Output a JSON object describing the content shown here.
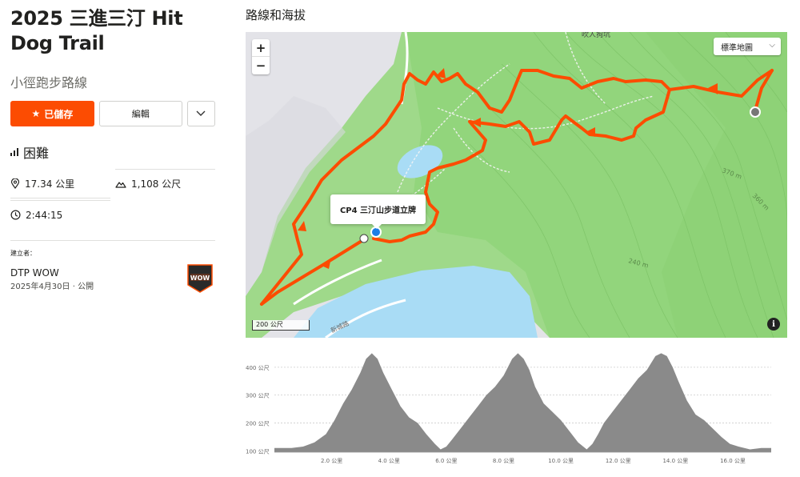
{
  "route": {
    "title": "2025 三進三汀 Hit Dog Trail",
    "type": "小徑跑步路線",
    "save_label": "已儲存",
    "edit_label": "編輯",
    "difficulty": "困難",
    "distance": "17.34 公里",
    "elevation_gain": "1,108 公尺",
    "duration": "2:44:15"
  },
  "creator": {
    "label": "建立者：",
    "name": "DTP WOW",
    "date": "2025年4月30日 · 公開",
    "badge_text": "WOW"
  },
  "map": {
    "section_title": "路線和海拔",
    "zoom_in": "+",
    "zoom_out": "−",
    "map_type": "標準地圖",
    "popup": "CP4 三汀山步道立牌",
    "scale": "200 公尺",
    "info": "i",
    "labels": [
      "吹人狗坑",
      "370 m",
      "360 m",
      "240 m",
      "新城路"
    ],
    "colors": {
      "route": "#fc4c02",
      "land": "#9fd98a",
      "water": "#a9dcf5",
      "urban": "#e6e6ea"
    }
  },
  "chart_data": {
    "type": "area",
    "title": "",
    "xlabel": "",
    "ylabel": "",
    "x_ticks": [
      "2.0 公里",
      "4.0 公里",
      "6.0 公里",
      "8.0 公里",
      "10.0 公里",
      "12.0 公里",
      "14.0 公里",
      "16.0 公里"
    ],
    "y_ticks": [
      "100 公尺",
      "200 公尺",
      "300 公尺",
      "400 公尺"
    ],
    "xlim": [
      0,
      17.34
    ],
    "ylim": [
      95,
      480
    ],
    "x": [
      0,
      0.6,
      1.0,
      1.4,
      1.8,
      2.1,
      2.4,
      2.7,
      3.0,
      3.2,
      3.4,
      3.6,
      3.8,
      4.1,
      4.4,
      4.7,
      5.0,
      5.3,
      5.6,
      5.8,
      6.0,
      6.2,
      6.5,
      6.8,
      7.1,
      7.4,
      7.7,
      8.0,
      8.3,
      8.5,
      8.7,
      8.9,
      9.1,
      9.4,
      9.7,
      10.0,
      10.3,
      10.6,
      10.9,
      11.1,
      11.3,
      11.5,
      11.8,
      12.1,
      12.4,
      12.7,
      13.0,
      13.3,
      13.5,
      13.7,
      13.9,
      14.1,
      14.4,
      14.7,
      15.0,
      15.3,
      15.6,
      15.9,
      16.2,
      16.6,
      17.0,
      17.34
    ],
    "y": [
      110,
      110,
      115,
      130,
      160,
      210,
      270,
      320,
      380,
      430,
      450,
      430,
      380,
      320,
      260,
      220,
      200,
      160,
      125,
      105,
      115,
      140,
      180,
      220,
      260,
      300,
      330,
      370,
      430,
      450,
      430,
      390,
      330,
      270,
      240,
      210,
      170,
      130,
      105,
      125,
      160,
      200,
      240,
      280,
      320,
      360,
      390,
      440,
      450,
      440,
      400,
      350,
      280,
      230,
      210,
      180,
      150,
      125,
      115,
      105,
      110,
      110
    ],
    "color": "#8a8a8a"
  }
}
